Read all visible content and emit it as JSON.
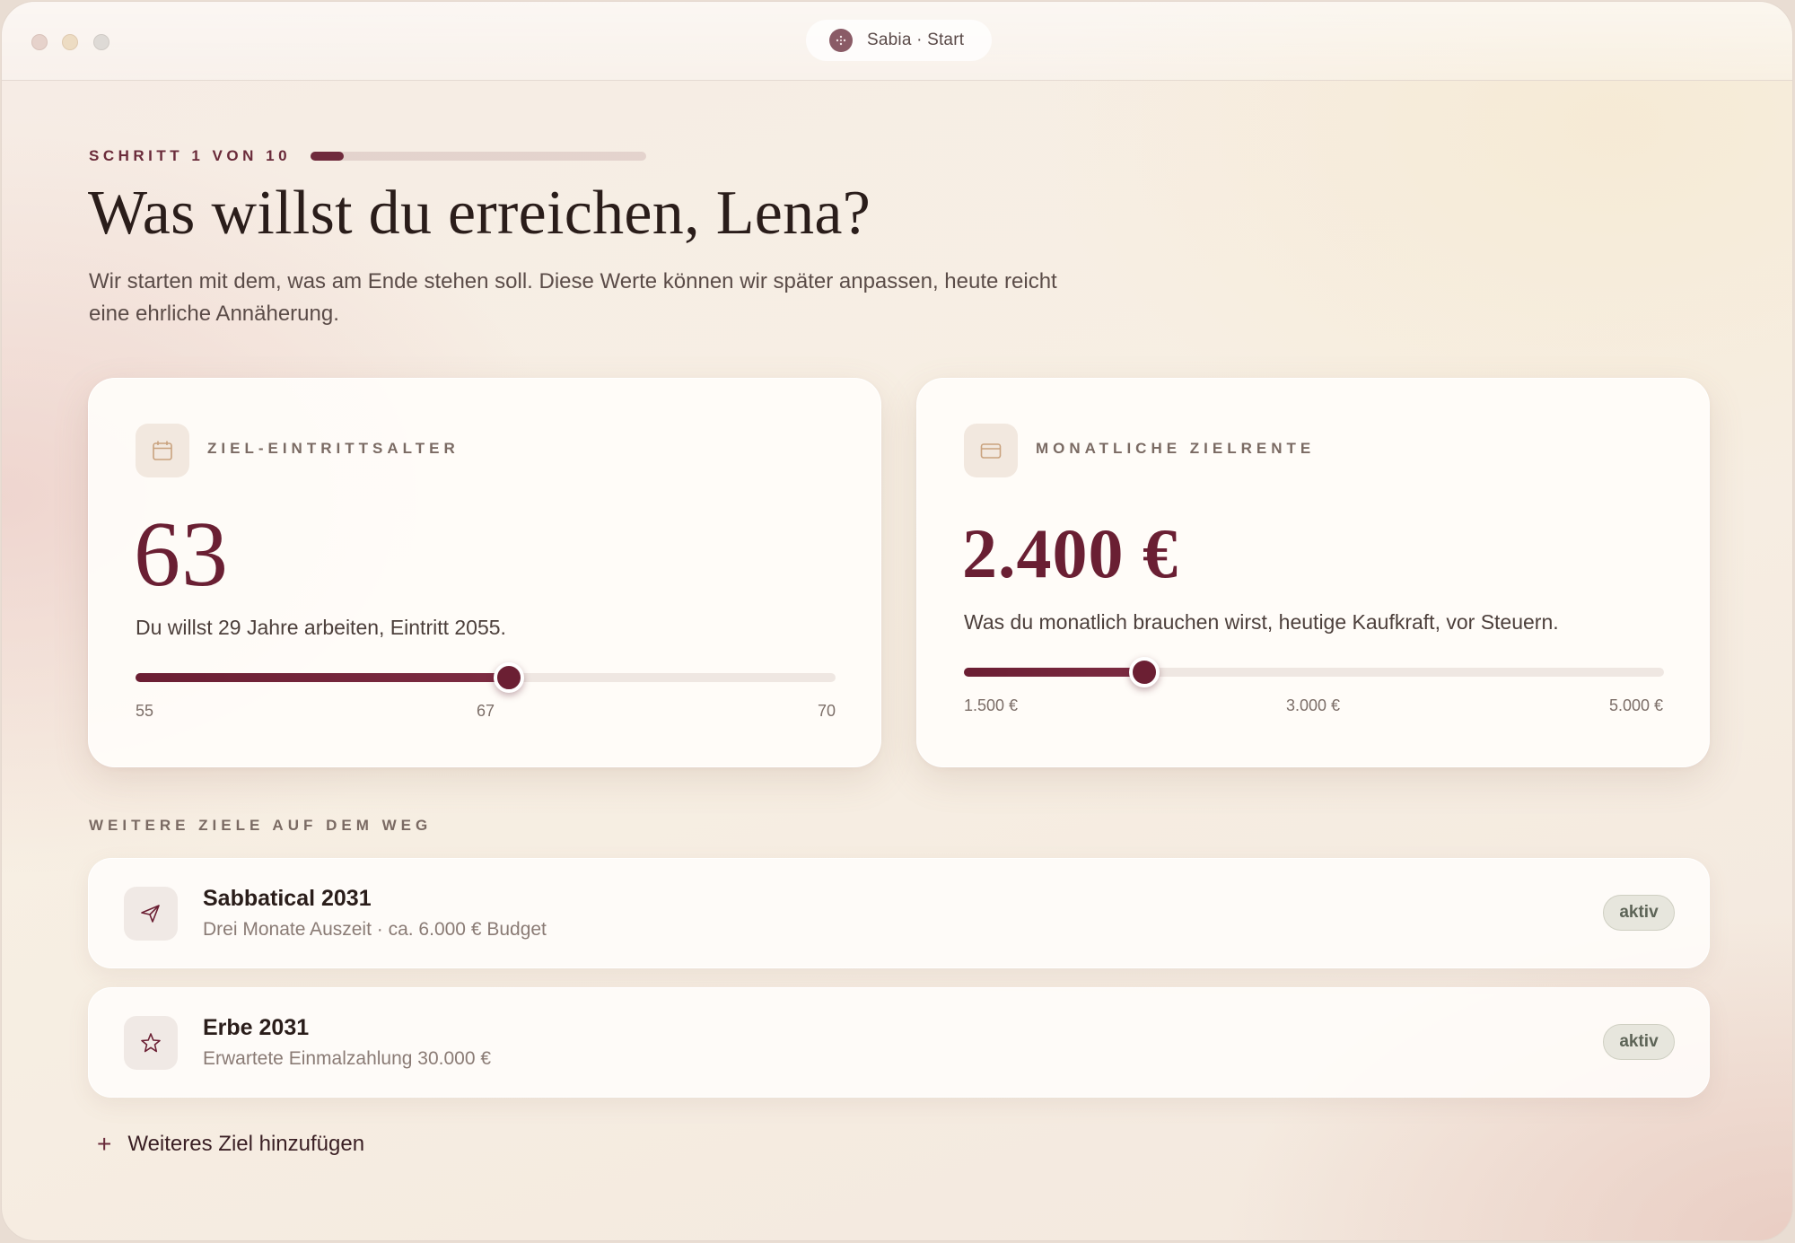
{
  "window": {
    "title": "Sabia · Start"
  },
  "header": {
    "step_label": "SCHRITT 1 VON 10",
    "step_progress": 0.1,
    "title": "Was willst du erreichen, Lena?",
    "intro": "Wir starten mit dem, was am Ende stehen soll. Diese Werte können wir später anpassen, heute reicht eine ehrliche Annäherung."
  },
  "cards": {
    "age": {
      "icon": "calendar-icon",
      "label": "ZIEL-EINTRITTSALTER",
      "value": "63",
      "description": "Du willst 29 Jahre arbeiten, Eintritt 2055.",
      "slider": {
        "min": 55,
        "max": 70,
        "value": 63,
        "ticks": [
          "55",
          "67",
          "70"
        ]
      }
    },
    "pension": {
      "icon": "card-icon",
      "label": "MONATLICHE ZIELRENTE",
      "value": "2.400 €",
      "description": "Was du monatlich brauchen wirst, heutige Kaufkraft, vor Steuern.",
      "slider": {
        "min": 1500,
        "max": 5000,
        "value": 2400,
        "ticks": [
          "1.500 €",
          "3.000 €",
          "5.000 €"
        ]
      }
    }
  },
  "goals": {
    "section_label": "WEITERE ZIELE AUF DEM WEG",
    "items": [
      {
        "icon": "paper-plane-icon",
        "title": "Sabbatical 2031",
        "subtitle": "Drei Monate Auszeit · ca. 6.000 € Budget",
        "badge": "aktiv"
      },
      {
        "icon": "star-icon",
        "title": "Erbe 2031",
        "subtitle": "Erwartete Einmalzahlung 30.000 €",
        "badge": "aktiv"
      }
    ],
    "add_label": "Weiteres Ziel hinzufügen"
  },
  "colors": {
    "accent": "#6b1f33",
    "badge_bg": "#e7e6dd"
  }
}
